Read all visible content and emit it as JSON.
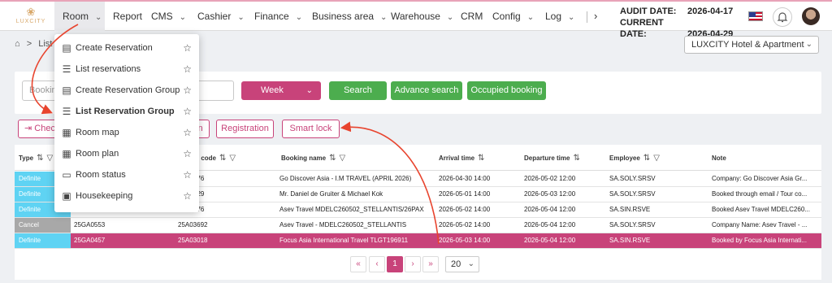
{
  "brand": {
    "logo_text": "LUXCITY"
  },
  "nav": {
    "items": [
      {
        "label": "Room",
        "chevron": true
      },
      {
        "label": "Report",
        "chevron": false
      },
      {
        "label": "CMS",
        "chevron": true
      },
      {
        "label": "Cashier",
        "chevron": true
      },
      {
        "label": "Finance",
        "chevron": true
      },
      {
        "label": "Business area",
        "chevron": true
      },
      {
        "label": "Warehouse",
        "chevron": true
      },
      {
        "label": "CRM",
        "chevron": false
      },
      {
        "label": "Config",
        "chevron": true
      },
      {
        "label": "Log",
        "chevron": true
      }
    ],
    "more_icon": "chevron-right-icon"
  },
  "dates": {
    "audit_label": "AUDIT DATE:",
    "audit_value": "2026-04-17",
    "current_label": "CURRENT DATE:",
    "current_value": "2026-04-29"
  },
  "breadcrumb": {
    "home_icon": "home-icon",
    "separator": ">",
    "current": "List R"
  },
  "hotel": {
    "selected": "LUXCITY Hotel & Apartment"
  },
  "filters": {
    "booking_placeholder": "Booking",
    "period": "Week",
    "search_label": "Search",
    "advance_label": "Advance search",
    "occupied_label": "Occupied booking"
  },
  "actions": {
    "checkin_label": "Chec",
    "room_label": "n",
    "registration_label": "Registration",
    "smartlock_label": "Smart lock"
  },
  "table": {
    "headers": {
      "type": "Type",
      "room_code": "m code",
      "booking_name": "Booking name",
      "arrival": "Arrival time",
      "departure": "Departure time",
      "employee": "Employee",
      "note": "Note"
    },
    "rows": [
      {
        "type": "Definite",
        "type_color": "#5fd3f3",
        "code": "",
        "room_code": "576",
        "name": "Go Discover Asia - I.M TRAVEL (APRIL 2026)",
        "arrival": "2026-04-30 14:00",
        "departure": "2026-05-02 12:00",
        "employee": "SA.SOLY.SRSV",
        "note": "Company: Go Discover Asia Gr..."
      },
      {
        "type": "Definite",
        "type_color": "#5fd3f3",
        "code": "",
        "room_code": "729",
        "name": "Mr. Daniel de Gruiter & Michael Kok",
        "arrival": "2026-05-01 14:00",
        "departure": "2026-05-03 12:00",
        "employee": "SA.SOLY.SRSV",
        "note": "Booked through email / Tour co..."
      },
      {
        "type": "Definite",
        "type_color": "#5fd3f3",
        "code": "",
        "room_code": "576",
        "name": "Asev Travel MDELC260502_STELLANTIS/26PAX",
        "arrival": "2026-05-02 14:00",
        "departure": "2026-05-04 12:00",
        "employee": "SA.SIN.RSVE",
        "note": "Booked Asev Travel MDELC260..."
      },
      {
        "type": "Cancel",
        "type_color": "#a8a8a8",
        "code": "25GA0553",
        "room_code": "25A03692",
        "name": "Asev Travel - MDELC260502_STELLANTIS",
        "arrival": "2026-05-02 14:00",
        "departure": "2026-05-04 12:00",
        "employee": "SA.SOLY.SRSV",
        "note": "Company Name: Asev Travel - ..."
      },
      {
        "type": "Definite",
        "type_color": "#5fd3f3",
        "code": "25GA0457",
        "room_code": "25A03018",
        "name": "Focus Asia International Travel TLGT196911",
        "arrival": "2026-05-03 14:00",
        "departure": "2026-05-04 12:00",
        "employee": "SA.SIN.RSVE",
        "note": "Booked by Focus Asia Internati..."
      }
    ]
  },
  "pagination": {
    "first": "«",
    "prev": "‹",
    "page": "1",
    "next": "›",
    "last": "»",
    "page_size": "20"
  },
  "room_menu": {
    "items": [
      {
        "label": "Create Reservation",
        "icon": "document-icon"
      },
      {
        "label": "List reservations",
        "icon": "list-icon"
      },
      {
        "label": "Create Reservation Group",
        "icon": "document-icon"
      },
      {
        "label": "List Reservation Group",
        "icon": "list-icon"
      },
      {
        "label": "Room map",
        "icon": "building-icon"
      },
      {
        "label": "Room plan",
        "icon": "building-icon"
      },
      {
        "label": "Room status",
        "icon": "monitor-icon"
      },
      {
        "label": "Housekeeping",
        "icon": "housekeeping-icon"
      }
    ]
  },
  "colors": {
    "accent": "#c8437a",
    "green": "#4cad4e",
    "definite": "#5fd3f3",
    "cancel": "#a8a8a8",
    "annotation_arrow": "#e8442e"
  }
}
